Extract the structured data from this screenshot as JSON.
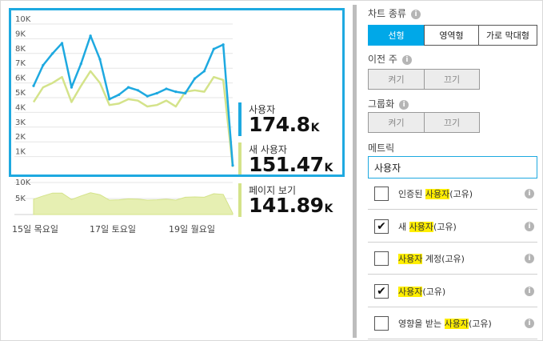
{
  "chart_data": {
    "type": "line",
    "y_ticks": [
      "10K",
      "9K",
      "8K",
      "7K",
      "6K",
      "5K",
      "4K",
      "3K",
      "2K",
      "1K"
    ],
    "ylim": [
      0,
      10000
    ],
    "x_labels": [
      "15일 목요일",
      "17일 토요일",
      "19일 월요일"
    ],
    "series": [
      {
        "name": "사용자",
        "color": "#1ea9e0",
        "values": [
          5800,
          7200,
          8000,
          8700,
          5700,
          7300,
          9200,
          7600,
          4900,
          5200,
          5700,
          5500,
          5100,
          5300,
          5600,
          5400,
          5300,
          6300,
          6800,
          8300,
          8600,
          400
        ]
      },
      {
        "name": "새 사용자",
        "color": "#d4e38a",
        "values": [
          4700,
          5700,
          6000,
          6400,
          4700,
          5800,
          6800,
          6000,
          4500,
          4600,
          4900,
          4800,
          4400,
          4500,
          4800,
          4400,
          5400,
          5500,
          5400,
          6400,
          6200,
          300
        ]
      }
    ],
    "mini": {
      "y_ticks": [
        "10K",
        "5K"
      ],
      "ylim": [
        0,
        10000
      ],
      "values": [
        4800,
        5800,
        6700,
        6700,
        4700,
        5800,
        6800,
        6200,
        4500,
        4600,
        4900,
        4800,
        4500,
        4600,
        4800,
        4500,
        5400,
        5500,
        5400,
        6500,
        6300,
        400
      ]
    }
  },
  "legend": [
    {
      "name": "사용자",
      "value": "174.8",
      "unit": "K",
      "color": "#1ea9e0"
    },
    {
      "name": "새 사용자",
      "value": "151.47",
      "unit": "K",
      "color": "#d4e38a"
    },
    {
      "name": "페이지 보기",
      "value": "141.89",
      "unit": "K",
      "color": "#d4e38a"
    }
  ],
  "panel": {
    "chart_type": {
      "title": "차트 종류",
      "options": [
        "선형",
        "영역형",
        "가로 막대형"
      ],
      "selected": "선형"
    },
    "previous_week": {
      "title": "이전 주",
      "options": [
        "켜기",
        "끄기"
      ]
    },
    "grouping": {
      "title": "그룹화",
      "options": [
        "켜기",
        "끄기"
      ]
    },
    "metric": {
      "title": "메트릭",
      "value": "사용자"
    },
    "metrics": [
      {
        "checked": false,
        "pre": "인증된 ",
        "hl": "사용자",
        "post": "(고유)"
      },
      {
        "checked": true,
        "pre": "새 ",
        "hl": "사용자",
        "post": "(고유)"
      },
      {
        "checked": false,
        "pre": "",
        "hl": "사용자",
        "post": " 계정(고유)"
      },
      {
        "checked": true,
        "pre": "",
        "hl": "사용자",
        "post": "(고유)"
      },
      {
        "checked": false,
        "pre": "영향을 받는 ",
        "hl": "사용자",
        "post": "(고유)"
      }
    ],
    "info_glyph": "i",
    "check_glyph": "✔"
  }
}
